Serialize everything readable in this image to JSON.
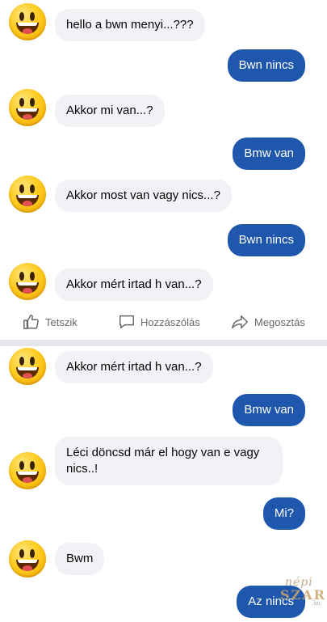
{
  "screen1": {
    "messages": [
      {
        "side": "in",
        "text": "hello a bwn menyi...???"
      },
      {
        "side": "out",
        "text": "Bwn nincs"
      },
      {
        "side": "in",
        "text": "Akkor mi van...?"
      },
      {
        "side": "out",
        "text": "Bmw van"
      },
      {
        "side": "in",
        "text": "Akkor most van vagy nics...?"
      },
      {
        "side": "out",
        "text": "Bwn nincs"
      },
      {
        "side": "in",
        "text": "Akkor mért irtad h van...?"
      }
    ]
  },
  "actions": {
    "like": "Tetszik",
    "comment": "Hozzászólás",
    "share": "Megosztás"
  },
  "screen2": {
    "messages": [
      {
        "side": "in",
        "text": "Akkor mért irtad h van...?"
      },
      {
        "side": "out",
        "text": "Bmw van"
      },
      {
        "side": "in",
        "text": "Léci döncsd már el hogy van e vagy nics..!"
      },
      {
        "side": "out",
        "text": "Mi?"
      },
      {
        "side": "in",
        "text": "Bwm"
      },
      {
        "side": "out",
        "text": "Az nincs"
      }
    ]
  },
  "watermark": {
    "line1": "népi",
    "line2": "SZAR",
    "line3": ".hu"
  },
  "colors": {
    "outgoing": "#1f57ad",
    "incoming": "#f0f2f5",
    "action_text": "#65676b"
  }
}
